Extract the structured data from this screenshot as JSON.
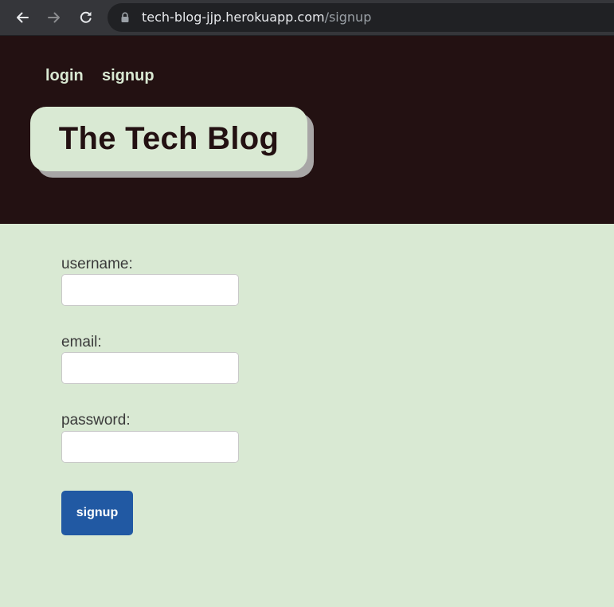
{
  "browser": {
    "url_host": "tech-blog-jjp.herokuapp.com",
    "url_path": "/signup",
    "icons": [
      "back-arrow-icon",
      "forward-arrow-icon",
      "reload-icon",
      "lock-icon"
    ]
  },
  "header": {
    "nav": {
      "login": "login",
      "signup": "signup"
    },
    "title": "The Tech Blog"
  },
  "form": {
    "username_label": "username:",
    "username_value": "",
    "email_label": "email:",
    "email_value": "",
    "password_label": "password:",
    "password_value": "",
    "submit_label": "signup"
  },
  "colors": {
    "header_bg": "#231112",
    "page_bg": "#d9e9d3",
    "nav_text": "#d9e9d3",
    "title_box_bg": "#d9e9d3",
    "title_shadow": "#a8a6a6",
    "button_bg": "#2159a3",
    "button_text": "#ffffff"
  }
}
